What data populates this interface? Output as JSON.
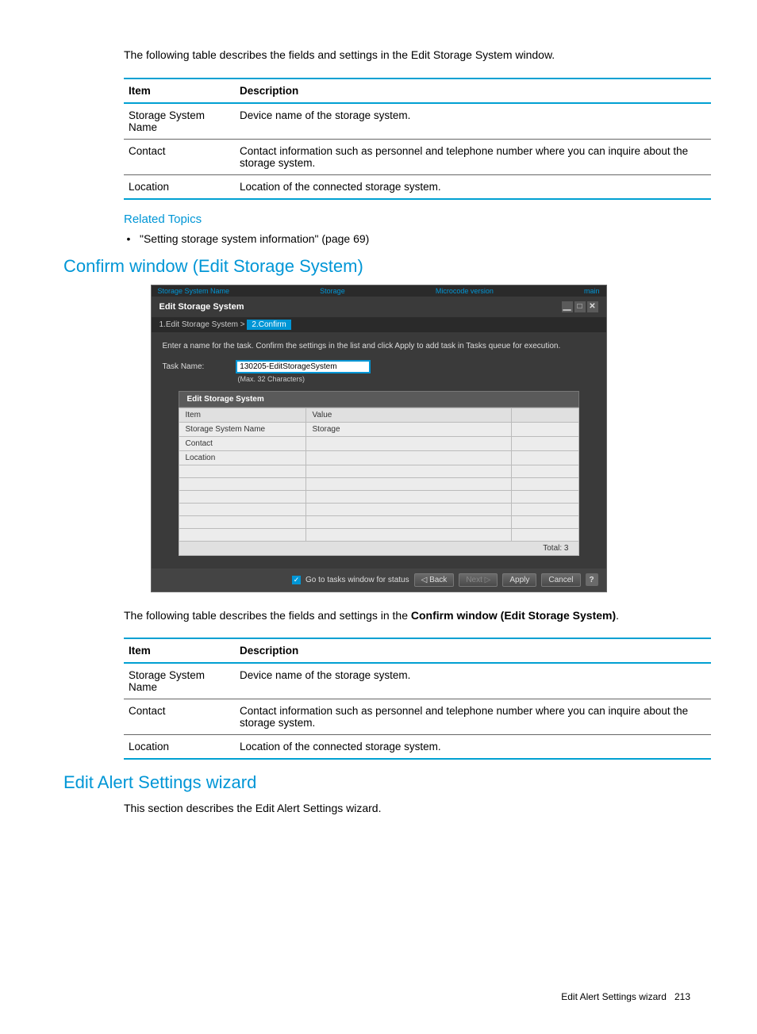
{
  "intro1": "The following table describes the fields and settings in the Edit Storage System window.",
  "table1": {
    "head": {
      "c0": "Item",
      "c1": "Description"
    },
    "rows": [
      {
        "c0": "Storage System Name",
        "c1": "Device name of the storage system."
      },
      {
        "c0": "Contact",
        "c1": "Contact information such as personnel and telephone number where you can inquire about the storage system."
      },
      {
        "c0": "Location",
        "c1": "Location of the connected storage system."
      }
    ]
  },
  "relatedTopics": {
    "heading": "Related Topics",
    "item": "\"Setting storage system information\" (page 69)"
  },
  "section1": "Confirm window (Edit Storage System)",
  "screenshot": {
    "topstrip": {
      "left": "Storage System Name",
      "mid": "Storage",
      "right1": "Microcode version",
      "right2": "main"
    },
    "title": "Edit Storage System",
    "breadcrumb": {
      "step1": "1.Edit Storage System  >",
      "step2": "2.Confirm"
    },
    "instruction": "Enter a name for the task. Confirm the settings in the list and click Apply to add task in Tasks queue for execution.",
    "taskLabel": "Task Name:",
    "taskValue": "130205-EditStorageSystem",
    "taskHint": "(Max. 32 Characters)",
    "panelTitle": "Edit Storage System",
    "grid": {
      "head": {
        "c0": "Item",
        "c1": "Value"
      },
      "rows": [
        {
          "c0": "Storage System Name",
          "c1": "Storage"
        },
        {
          "c0": "Contact",
          "c1": ""
        },
        {
          "c0": "Location",
          "c1": ""
        }
      ]
    },
    "total": "Total: 3",
    "footer": {
      "checkLabel": "Go to tasks window for status",
      "back": "Back",
      "next": "Next",
      "apply": "Apply",
      "cancel": "Cancel"
    }
  },
  "intro2_pre": "The following table describes the fields and settings in the ",
  "intro2_bold": "Confirm window (Edit Storage System)",
  "intro2_post": ".",
  "table2": {
    "head": {
      "c0": "Item",
      "c1": "Description"
    },
    "rows": [
      {
        "c0": "Storage System Name",
        "c1": "Device name of the storage system."
      },
      {
        "c0": "Contact",
        "c1": "Contact information such as personnel and telephone number where you can inquire about the storage system."
      },
      {
        "c0": "Location",
        "c1": "Location of the connected storage system."
      }
    ]
  },
  "section2": "Edit Alert Settings wizard",
  "section2_body": "This section describes the Edit Alert Settings wizard.",
  "footer": {
    "text": "Edit Alert Settings wizard",
    "page": "213"
  }
}
